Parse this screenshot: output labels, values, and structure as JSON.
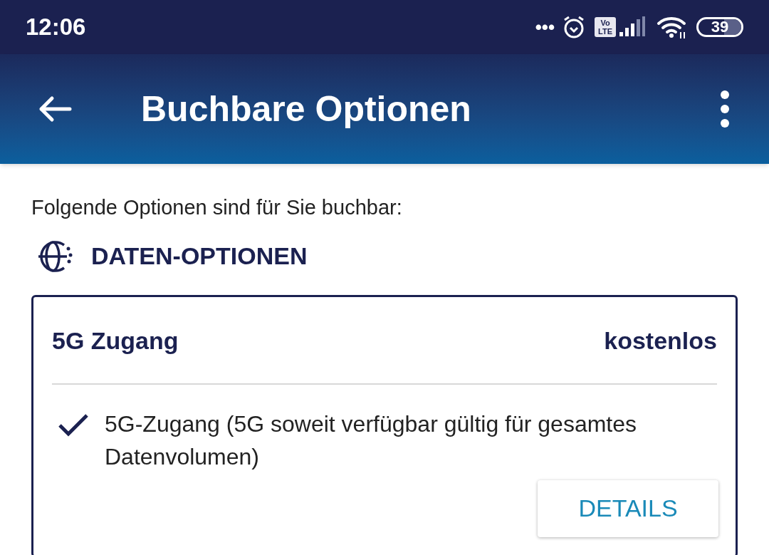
{
  "status_bar": {
    "time": "12:06",
    "more": "•••",
    "volte": [
      "Vo",
      "LTE"
    ],
    "battery": "39"
  },
  "app_bar": {
    "title": "Buchbare Optionen"
  },
  "intro": "Folgende Optionen sind für Sie buchbar:",
  "section": {
    "title": "DATEN-OPTIONEN"
  },
  "cards": [
    {
      "name": "5G Zugang",
      "price": "kostenlos",
      "features": [
        "5G-Zugang (5G soweit verfügbar gültig für gesamtes Datenvolumen)"
      ],
      "button": "DETAILS"
    }
  ]
}
